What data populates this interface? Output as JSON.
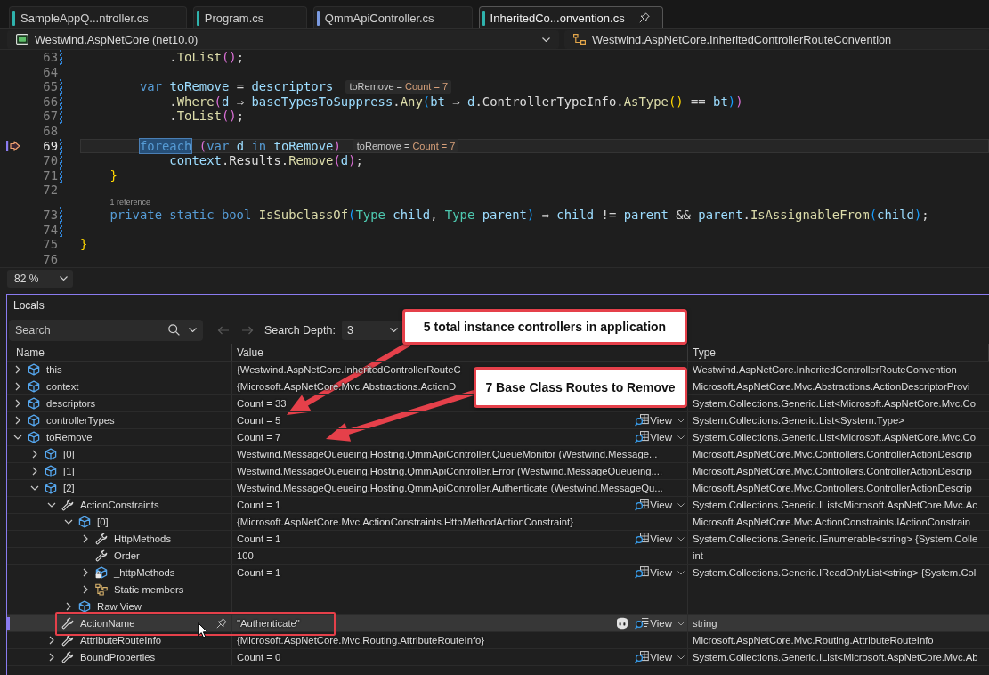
{
  "tabs": [
    {
      "label": "SampleAppQ...ntroller.cs",
      "color": "#2fb3ad",
      "selected": false,
      "pinned": false
    },
    {
      "label": "Program.cs",
      "color": "#2fb3ad",
      "selected": false,
      "pinned": false
    },
    {
      "label": "QmmApiController.cs",
      "color": "#7a9ae0",
      "selected": false,
      "pinned": false
    },
    {
      "label": "InheritedCo...onvention.cs",
      "color": "#2fb3ad",
      "selected": true,
      "pinned": true
    }
  ],
  "navigation_bar": {
    "project": "Westwind.AspNetCore (net10.0)",
    "member": "Westwind.AspNetCore.InheritedControllerRouteConvention"
  },
  "editor": {
    "lines": [
      {
        "number": "63",
        "changed": true,
        "current": false,
        "tokens": [
          {
            "text": "            .",
            "kind": "plain"
          },
          {
            "text": "ToList",
            "kind": "method"
          },
          {
            "text": "()",
            "kind": "bracket-2"
          },
          {
            "text": ";",
            "kind": "plain"
          }
        ]
      },
      {
        "number": "64",
        "changed": false,
        "current": false
      },
      {
        "number": "65",
        "changed": true,
        "current": false,
        "tokens": [
          {
            "text": "        var",
            "kind": "keyword"
          },
          {
            "text": " toRemove",
            "kind": "local"
          },
          {
            "text": " = ",
            "kind": "plain"
          },
          {
            "text": "descriptors",
            "kind": "local"
          }
        ],
        "hint": {
          "label": "toRemove =",
          "value": "Count = 7"
        }
      },
      {
        "number": "66",
        "changed": true,
        "current": false,
        "tokens": [
          {
            "text": "            .",
            "kind": "plain"
          },
          {
            "text": "Where",
            "kind": "method"
          },
          {
            "text": "(",
            "kind": "bracket-2"
          },
          {
            "text": "d",
            "kind": "local"
          },
          {
            "text": " ⇒ ",
            "kind": "plain"
          },
          {
            "text": "baseTypesToSuppress",
            "kind": "field"
          },
          {
            "text": ".",
            "kind": "plain"
          },
          {
            "text": "Any",
            "kind": "method"
          },
          {
            "text": "(",
            "kind": "bracket-3"
          },
          {
            "text": "bt",
            "kind": "local"
          },
          {
            "text": " ⇒ ",
            "kind": "plain"
          },
          {
            "text": "d",
            "kind": "local"
          },
          {
            "text": ".",
            "kind": "plain"
          },
          {
            "text": "ControllerTypeInfo",
            "kind": "member"
          },
          {
            "text": ".",
            "kind": "plain"
          },
          {
            "text": "AsType",
            "kind": "method"
          },
          {
            "text": "()",
            "kind": "bracket-1"
          },
          {
            "text": " == ",
            "kind": "plain"
          },
          {
            "text": "bt",
            "kind": "local"
          },
          {
            "text": ")",
            "kind": "bracket-3"
          },
          {
            "text": ")",
            "kind": "bracket-2"
          }
        ]
      },
      {
        "number": "67",
        "changed": true,
        "current": false,
        "tokens": [
          {
            "text": "            .",
            "kind": "plain"
          },
          {
            "text": "ToList",
            "kind": "method"
          },
          {
            "text": "()",
            "kind": "bracket-2"
          },
          {
            "text": ";",
            "kind": "plain"
          }
        ]
      },
      {
        "number": "68",
        "changed": false,
        "current": false
      },
      {
        "number": "69",
        "changed": true,
        "current": true,
        "tokens": [
          {
            "text": "        foreach",
            "kind": "keyword",
            "highlighted": true
          },
          {
            "text": " (",
            "kind": "bracket-2",
            "highlighted": false
          },
          {
            "text": "var",
            "kind": "keyword",
            "highlighted": false
          },
          {
            "text": " d ",
            "kind": "local",
            "highlighted": false
          },
          {
            "text": "in",
            "kind": "keyword",
            "highlighted": false
          },
          {
            "text": " toRemove",
            "kind": "local",
            "highlighted": false
          },
          {
            "text": ")",
            "kind": "bracket-2",
            "highlighted": false
          }
        ],
        "hint": {
          "label": "toRemove =",
          "value": "Count = 7"
        }
      },
      {
        "number": "70",
        "changed": true,
        "current": false,
        "tokens": [
          {
            "text": "            context",
            "kind": "local"
          },
          {
            "text": ".",
            "kind": "plain"
          },
          {
            "text": "Results",
            "kind": "member"
          },
          {
            "text": ".",
            "kind": "plain"
          },
          {
            "text": "Remove",
            "kind": "method"
          },
          {
            "text": "(",
            "kind": "bracket-2"
          },
          {
            "text": "d",
            "kind": "local"
          },
          {
            "text": ")",
            "kind": "bracket-2"
          },
          {
            "text": ";",
            "kind": "plain"
          }
        ]
      },
      {
        "number": "71",
        "changed": true,
        "current": false,
        "tokens": [
          {
            "text": "    }",
            "kind": "bracket-1"
          }
        ]
      },
      {
        "number": "72",
        "changed": false,
        "current": false
      },
      {
        "number": "73",
        "changed": true,
        "current": false,
        "codelens": "1 reference",
        "tokens": [
          {
            "text": "    private static bool",
            "kind": "keyword"
          },
          {
            "text": " IsSubclassOf",
            "kind": "method"
          },
          {
            "text": "(",
            "kind": "bracket-3"
          },
          {
            "text": "Type",
            "kind": "type"
          },
          {
            "text": " child",
            "kind": "local"
          },
          {
            "text": ", ",
            "kind": "plain"
          },
          {
            "text": "Type",
            "kind": "type"
          },
          {
            "text": " parent",
            "kind": "local"
          },
          {
            "text": ")",
            "kind": "bracket-3"
          },
          {
            "text": " ⇒ ",
            "kind": "plain"
          },
          {
            "text": "child",
            "kind": "local"
          },
          {
            "text": " != ",
            "kind": "plain"
          },
          {
            "text": "parent",
            "kind": "local"
          },
          {
            "text": " && ",
            "kind": "plain"
          },
          {
            "text": "parent",
            "kind": "local"
          },
          {
            "text": ".",
            "kind": "plain"
          },
          {
            "text": "IsAssignableFrom",
            "kind": "method"
          },
          {
            "text": "(",
            "kind": "bracket-3"
          },
          {
            "text": "child",
            "kind": "local"
          },
          {
            "text": ")",
            "kind": "bracket-3"
          },
          {
            "text": ";",
            "kind": "plain"
          }
        ]
      },
      {
        "number": "74",
        "changed": true,
        "current": false
      },
      {
        "number": "75",
        "changed": false,
        "current": false,
        "tokens": [
          {
            "text": "}",
            "kind": "bracket-1"
          }
        ]
      },
      {
        "number": "76",
        "changed": false,
        "current": false
      }
    ],
    "zoom": "82 %"
  },
  "locals": {
    "title": "Locals",
    "search": {
      "placeholder": "Search"
    },
    "back": {
      "disabled": true
    },
    "forward": {
      "disabled": true
    },
    "search_depth": {
      "label": "Search Depth:",
      "value": "3"
    },
    "columns": [
      "Name",
      "Value",
      "Type"
    ],
    "rows": [
      {
        "name": "this",
        "kind": "variable",
        "expanded": false,
        "selected": false,
        "hovered": false,
        "value": "{Westwind.AspNetCore.InheritedControllerRouteC",
        "type": "Westwind.AspNetCore.InheritedControllerRouteConvention"
      },
      {
        "name": "context",
        "kind": "variable",
        "expanded": false,
        "selected": false,
        "hovered": false,
        "value": "{Microsoft.AspNetCore.Mvc.Abstractions.ActionD",
        "type": "Microsoft.AspNetCore.Mvc.Abstractions.ActionDescriptorProvi"
      },
      {
        "name": "descriptors",
        "kind": "variable",
        "expanded": false,
        "selected": false,
        "hovered": false,
        "value": "Count = 33",
        "type": "System.Collections.Generic.List<Microsoft.AspNetCore.Mvc.Co"
      },
      {
        "name": "controllerTypes",
        "kind": "variable",
        "expanded": false,
        "selected": false,
        "hovered": false,
        "value": "Count = 5",
        "view": {
          "label": "View",
          "kind": "list"
        },
        "type": "System.Collections.Generic.List<System.Type>"
      },
      {
        "name": "toRemove",
        "kind": "variable",
        "expanded": true,
        "selected": false,
        "hovered": false,
        "value": "Count = 7",
        "view": {
          "label": "View",
          "kind": "list"
        },
        "type": "System.Collections.Generic.List<Microsoft.AspNetCore.Mvc.Co",
        "children": [
          {
            "name": "[0]",
            "kind": "variable",
            "expanded": false,
            "selected": false,
            "hovered": false,
            "value": "Westwind.MessageQueueing.Hosting.QmmApiController.QueueMonitor (Westwind.Message...",
            "type": "Microsoft.AspNetCore.Mvc.Controllers.ControllerActionDescrip"
          },
          {
            "name": "[1]",
            "kind": "variable",
            "expanded": false,
            "selected": false,
            "hovered": false,
            "value": "Westwind.MessageQueueing.Hosting.QmmApiController.Error (Westwind.MessageQueueing....",
            "type": "Microsoft.AspNetCore.Mvc.Controllers.ControllerActionDescrip"
          },
          {
            "name": "[2]",
            "kind": "variable",
            "expanded": true,
            "selected": false,
            "hovered": false,
            "value": "Westwind.MessageQueueing.Hosting.QmmApiController.Authenticate (Westwind.MessageQu...",
            "type": "Microsoft.AspNetCore.Mvc.Controllers.ControllerActionDescrip",
            "children": [
              {
                "name": "ActionConstraints",
                "kind": "property",
                "expanded": true,
                "selected": false,
                "hovered": false,
                "value": "Count = 1",
                "view": {
                  "label": "View",
                  "kind": "list"
                },
                "type": "System.Collections.Generic.IList<Microsoft.AspNetCore.Mvc.Ac",
                "children": [
                  {
                    "name": "[0]",
                    "kind": "variable",
                    "expanded": true,
                    "selected": false,
                    "hovered": false,
                    "value": "{Microsoft.AspNetCore.Mvc.ActionConstraints.HttpMethodActionConstraint}",
                    "type": "Microsoft.AspNetCore.Mvc.ActionConstraints.IActionConstrain",
                    "children": [
                      {
                        "name": "HttpMethods",
                        "kind": "property",
                        "expanded": false,
                        "selected": false,
                        "hovered": false,
                        "value": "Count = 1",
                        "view": {
                          "label": "View",
                          "kind": "list"
                        },
                        "type": "System.Collections.Generic.IEnumerable<string> {System.Colle"
                      },
                      {
                        "name": "Order",
                        "kind": "property",
                        "selected": false,
                        "hovered": false,
                        "value": "100",
                        "type": "int"
                      },
                      {
                        "name": "_httpMethods",
                        "kind": "private-field",
                        "expanded": false,
                        "selected": false,
                        "hovered": false,
                        "value": "Count = 1",
                        "view": {
                          "label": "View",
                          "kind": "list"
                        },
                        "type": "System.Collections.Generic.IReadOnlyList<string> {System.Coll"
                      },
                      {
                        "name": "Static members",
                        "kind": "static",
                        "expanded": false,
                        "selected": false,
                        "hovered": false
                      }
                    ]
                  },
                  {
                    "name": "Raw View",
                    "kind": "variable",
                    "expanded": false,
                    "selected": false,
                    "hovered": false
                  }
                ]
              },
              {
                "name": "ActionName",
                "kind": "property",
                "selected": true,
                "hovered": true,
                "outlined": true,
                "value": "\"Authenticate\"",
                "view": {
                  "label": "View",
                  "kind": "text"
                },
                "type": "string"
              },
              {
                "name": "AttributeRouteInfo",
                "kind": "property",
                "expanded": false,
                "selected": false,
                "hovered": false,
                "value": "{Microsoft.AspNetCore.Mvc.Routing.AttributeRouteInfo}",
                "type": "Microsoft.AspNetCore.Mvc.Routing.AttributeRouteInfo"
              },
              {
                "name": "BoundProperties",
                "kind": "property",
                "expanded": false,
                "selected": false,
                "hovered": false,
                "value": "Count = 0",
                "view": {
                  "label": "View",
                  "kind": "list"
                },
                "type": "System.Collections.Generic.IList<Microsoft.AspNetCore.Mvc.Ab"
              }
            ]
          }
        ]
      }
    ]
  },
  "annotations": [
    {
      "kind": "callout",
      "text": "5 total instance controllers in application"
    },
    {
      "kind": "callout",
      "text": "7 Base Class Routes to Remove"
    }
  ]
}
